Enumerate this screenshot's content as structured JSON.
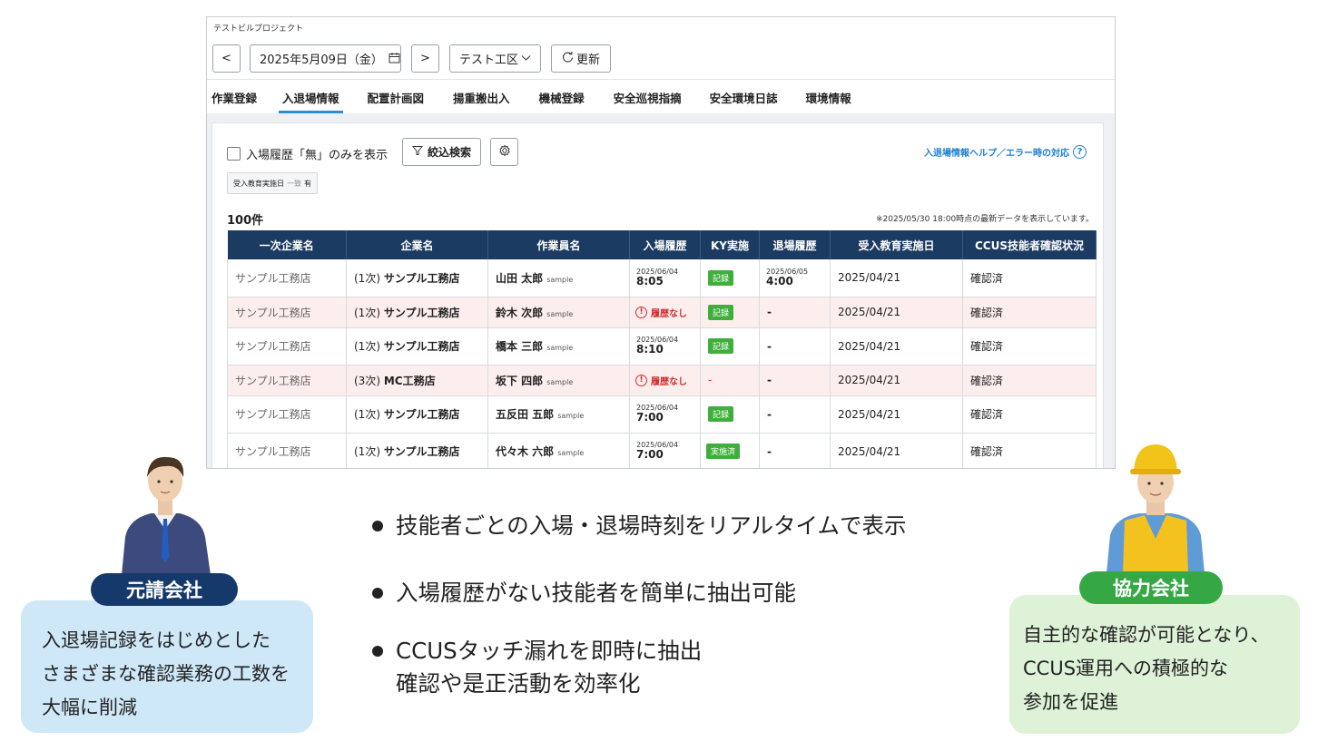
{
  "window": {
    "project_name": "テストビルプロジェクト",
    "prev_label": "<",
    "date_label": "2025年5月09日（金）",
    "next_label": ">",
    "area_label": "テスト工区",
    "refresh_label": "更新"
  },
  "tabs": [
    {
      "label": "作業登録",
      "active": false
    },
    {
      "label": "入退場情報",
      "active": true
    },
    {
      "label": "配置計画図",
      "active": false
    },
    {
      "label": "揚重搬出入",
      "active": false
    },
    {
      "label": "機械登録",
      "active": false
    },
    {
      "label": "安全巡視指摘",
      "active": false
    },
    {
      "label": "安全環境日誌",
      "active": false
    },
    {
      "label": "環境情報",
      "active": false
    }
  ],
  "filters": {
    "checkbox_label": "入場履歴「無」のみを表示",
    "filter_button": "絞込検索",
    "help_link": "入退場情報ヘルプ／エラー時の対応",
    "help_icon": "?",
    "chip_field": "受入教育実施日",
    "chip_op": "一致",
    "chip_value": "有"
  },
  "summary": {
    "count": "100件",
    "note": "※2025/05/30 18:00時点の最新データを表示しています。"
  },
  "table": {
    "headers": [
      "一次企業名",
      "企業名",
      "作業員名",
      "入場履歴",
      "KY実施",
      "退場履歴",
      "受入教育実施日",
      "CCUS技能者確認状況"
    ],
    "rows": [
      {
        "primary": "サンプル工務店",
        "tier": "(1次)",
        "company": "サンプル工務店",
        "worker": "山田 太郎",
        "tag": "sample",
        "entry_date": "2025/06/04",
        "entry_time": "8:05",
        "ky": "記録",
        "exit_date": "2025/06/05",
        "exit_time": "4:00",
        "edu": "2025/04/21",
        "ccus": "確認済"
      },
      {
        "primary": "サンプル工務店",
        "tier": "(1次)",
        "company": "サンプル工務店",
        "worker": "鈴木 次郎",
        "tag": "sample",
        "entry_alert": "履歴なし",
        "ky": "記録",
        "exit_dash": "-",
        "edu": "2025/04/21",
        "ccus": "確認済"
      },
      {
        "primary": "サンプル工務店",
        "tier": "(1次)",
        "company": "サンプル工務店",
        "worker": "橋本 三郎",
        "tag": "sample",
        "entry_date": "2025/06/04",
        "entry_time": "8:10",
        "ky": "記録",
        "exit_dash": "-",
        "edu": "2025/04/21",
        "ccus": "確認済"
      },
      {
        "primary": "サンプル工務店",
        "tier": "(3次)",
        "company": "MC工務店",
        "worker": "坂下 四郎",
        "tag": "sample",
        "entry_alert": "履歴なし",
        "ky_dash": "-",
        "exit_dash": "-",
        "edu": "2025/04/21",
        "ccus": "確認済"
      },
      {
        "primary": "サンプル工務店",
        "tier": "(1次)",
        "company": "サンプル工務店",
        "worker": "五反田 五郎",
        "tag": "sample",
        "entry_date": "2025/06/04",
        "entry_time": "7:00",
        "ky": "記録",
        "exit_dash": "-",
        "edu": "2025/04/21",
        "ccus": "確認済"
      },
      {
        "primary": "サンプル工務店",
        "tier": "(1次)",
        "company": "サンプル工務店",
        "worker": "代々木 六郎",
        "tag": "sample",
        "entry_date": "2025/06/04",
        "entry_time": "7:00",
        "ky": "実施済",
        "exit_dash": "-",
        "edu": "2025/04/21",
        "ccus": "確認済"
      }
    ]
  },
  "bullets": {
    "b1": "技能者ごとの入場・退場時刻をリアルタイムで表示",
    "b2": "入場履歴がない技能者を簡単に抽出可能",
    "b3_line1": "CCUSタッチ漏れを即時に抽出",
    "b3_line2": "確認や是正活動を効率化"
  },
  "left_callout": {
    "title": "元請会社",
    "line1": "入退場記録をはじめとした",
    "line2": "さまざまな確認業務の工数を",
    "line3": "大幅に削減"
  },
  "right_callout": {
    "title": "協力会社",
    "line1": "自主的な確認が可能となり、",
    "line2": "CCUS運用への積極的な",
    "line3": "参加を促進"
  },
  "colors": {
    "header_navy": "#1b3b63",
    "tab_accent": "#2a8fd6",
    "alert_row": "#fdeeee",
    "badge_green": "#3fae3c",
    "left_pill": "#15396b",
    "right_pill": "#35a845",
    "left_box": "#cfe8f8",
    "right_box": "#ddf2d6"
  },
  "icons": [
    "calendar-icon",
    "chevron-down-icon",
    "refresh-icon",
    "filter-icon",
    "gear-icon",
    "help-icon",
    "alert-icon"
  ]
}
